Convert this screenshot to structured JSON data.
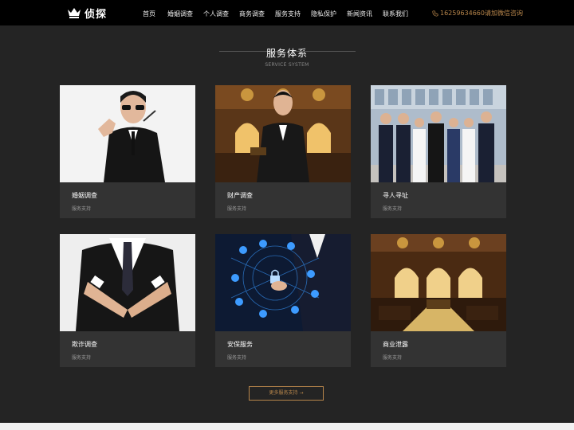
{
  "header": {
    "logo_text": "侦探",
    "nav": [
      "首页",
      "婚姻调查",
      "个人调查",
      "商务调查",
      "服务支持",
      "隐私保护",
      "新闻资讯",
      "联系我们"
    ],
    "phone": "16259634660请加微信咨询",
    "phone_icon": "phone-icon",
    "accent_color": "#b8864b"
  },
  "section": {
    "title": "服务体系",
    "subtitle": "SERVICE SYSTEM"
  },
  "cards": [
    {
      "title": "婚姻调查",
      "sub": "服务支持"
    },
    {
      "title": "财产调查",
      "sub": "服务支持"
    },
    {
      "title": "寻人寻址",
      "sub": "服务支持"
    },
    {
      "title": "欺诈调查",
      "sub": "服务支持"
    },
    {
      "title": "安保服务",
      "sub": "服务支持"
    },
    {
      "title": "商业泄露",
      "sub": "服务支持"
    }
  ],
  "more_button": "更多服务支持 →"
}
